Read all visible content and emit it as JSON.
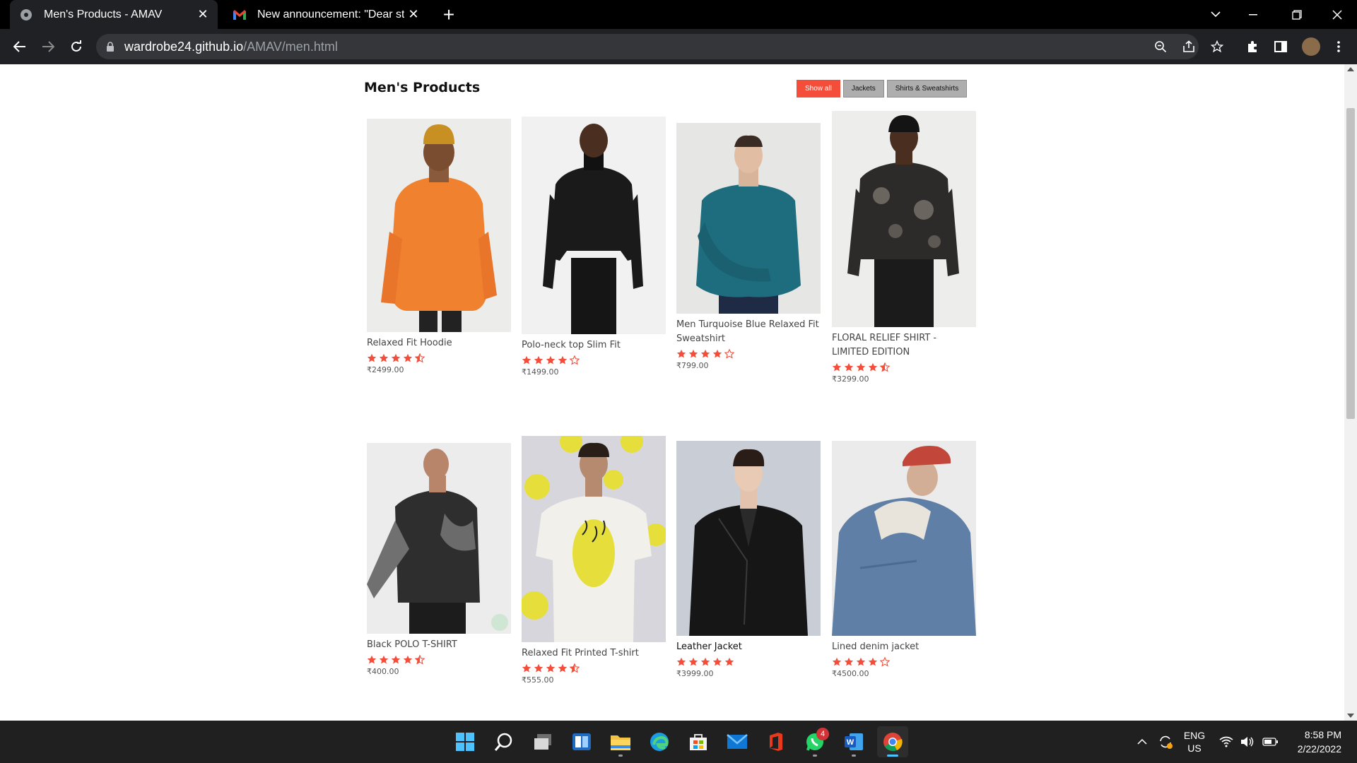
{
  "browser": {
    "tabs": [
      {
        "title": "Men's Products - AMAV",
        "active": true
      },
      {
        "title": "New announcement: \"Dear stude",
        "active": false
      }
    ],
    "url_host": "wardrobe24.github.io",
    "url_path": "/AMAV/men.html"
  },
  "page": {
    "title": "Men's Products",
    "filters": [
      {
        "label": "Show all",
        "active": true
      },
      {
        "label": "Jackets",
        "active": false
      },
      {
        "label": "Shirts & Sweatshirts",
        "active": false
      }
    ]
  },
  "products": [
    {
      "name": "Relaxed Fit Hoodie",
      "rating": 4.5,
      "price": "₹2499.00"
    },
    {
      "name": "Polo-neck top Slim Fit",
      "rating": 4,
      "price": "₹1499.00"
    },
    {
      "name": "Men Turquoise Blue Relaxed Fit Sweatshirt",
      "rating": 4,
      "price": "₹799.00"
    },
    {
      "name": "FLORAL RELIEF SHIRT - LIMITED EDITION",
      "rating": 4.5,
      "price": "₹3299.00"
    },
    {
      "name": "Black POLO T-SHIRT",
      "rating": 4.5,
      "price": "₹400.00"
    },
    {
      "name": "Relaxed Fit Printed T-shirt",
      "rating": 4.5,
      "price": "₹555.00"
    },
    {
      "name": "Leather Jacket",
      "rating": 5,
      "price": "₹3999.00"
    },
    {
      "name": "Lined denim jacket",
      "rating": 4,
      "price": "₹4500.00"
    }
  ],
  "taskbar": {
    "whatsapp_badge": "4",
    "lang_1": "ENG",
    "lang_2": "US",
    "time": "8:58 PM",
    "date": "2/22/2022"
  },
  "colors": {
    "accent": "#f44e3b",
    "star": "#f44e3b"
  }
}
